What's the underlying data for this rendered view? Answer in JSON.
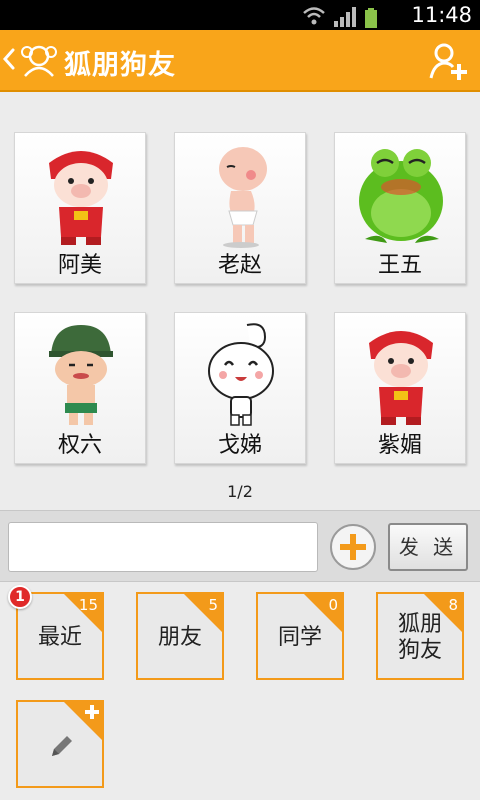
{
  "status_bar": {
    "time": "11:48",
    "icons": [
      "wifi-icon",
      "signal-icon",
      "battery-icon"
    ]
  },
  "header": {
    "title": "狐朋狗友",
    "back_icon": "chevron-left-icon",
    "logo_icon": "group-logo-icon",
    "action_icon": "add-user-icon"
  },
  "contacts": [
    {
      "name": "阿美",
      "avatar": "red-pig-avatar"
    },
    {
      "name": "老赵",
      "avatar": "baby-avatar"
    },
    {
      "name": "王五",
      "avatar": "frog-avatar"
    },
    {
      "name": "权六",
      "avatar": "soldier-avatar"
    },
    {
      "name": "戈娣",
      "avatar": "bun-avatar"
    },
    {
      "name": "紫媚",
      "avatar": "red-pig-avatar"
    }
  ],
  "pager": "1/2",
  "composer": {
    "input_value": "",
    "send_label": "发 送",
    "plus_icon": "plus-icon"
  },
  "groups": [
    {
      "label": "最近",
      "count": "15",
      "badge": "1"
    },
    {
      "label": "朋友",
      "count": "5"
    },
    {
      "label": "同学",
      "count": "0"
    },
    {
      "label": "狐朋\n狗友",
      "count": "8"
    }
  ],
  "add_group_icon": "pencil-icon",
  "colors": {
    "accent": "#f9a51a",
    "corner": "#f39a1a",
    "badge": "#e02a2a"
  }
}
